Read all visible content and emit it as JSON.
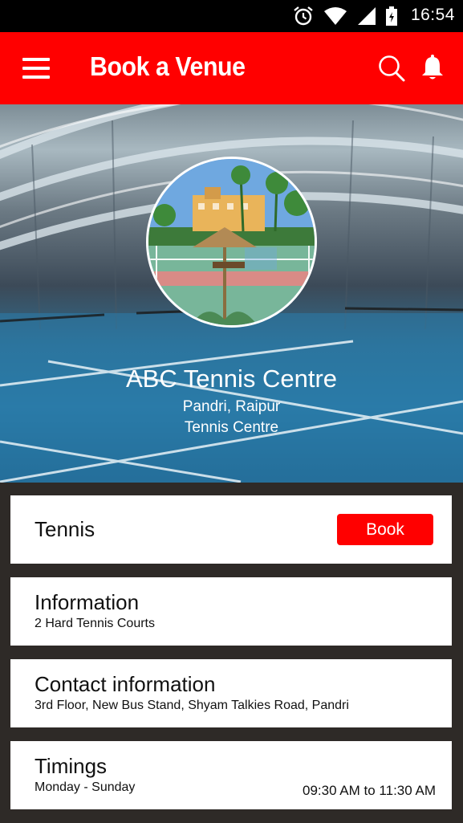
{
  "status_bar": {
    "time": "16:54",
    "icons": [
      "alarm-icon",
      "wifi-icon",
      "signal-icon",
      "battery-icon"
    ]
  },
  "app_bar": {
    "title": "Book a Venue",
    "background": "#ff0000",
    "icons": [
      "menu-icon",
      "search-icon",
      "bell-icon"
    ]
  },
  "venue": {
    "name": "ABC Tennis Centre",
    "location": "Pandri, Raipur",
    "type": "Tennis Centre"
  },
  "sport_card": {
    "title": "Tennis",
    "book_label": "Book"
  },
  "info_card": {
    "title": "Information",
    "detail": "2 Hard Tennis Courts"
  },
  "contact_card": {
    "title": "Contact information",
    "address": "3rd Floor, New Bus Stand, Shyam Talkies Road, Pandri"
  },
  "timings_card": {
    "title": "Timings",
    "days": "Monday - Sunday",
    "hours": "09:30 AM to 11:30 AM"
  }
}
